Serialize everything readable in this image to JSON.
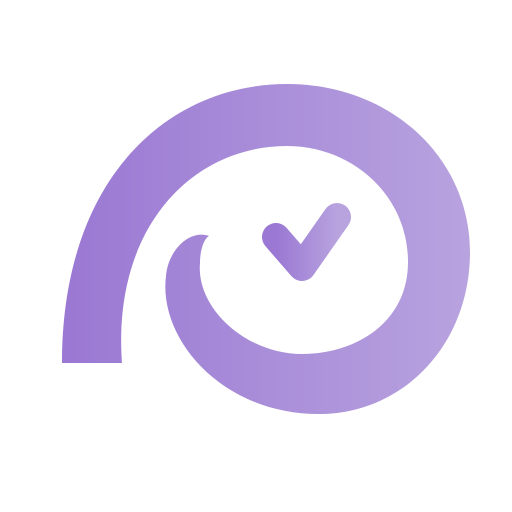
{
  "logo": {
    "icon": "spiral-checkmark-icon",
    "colors": {
      "background": "#ffffff",
      "gradient_start": "#9a78d3",
      "gradient_end": "#b8a3df"
    }
  }
}
